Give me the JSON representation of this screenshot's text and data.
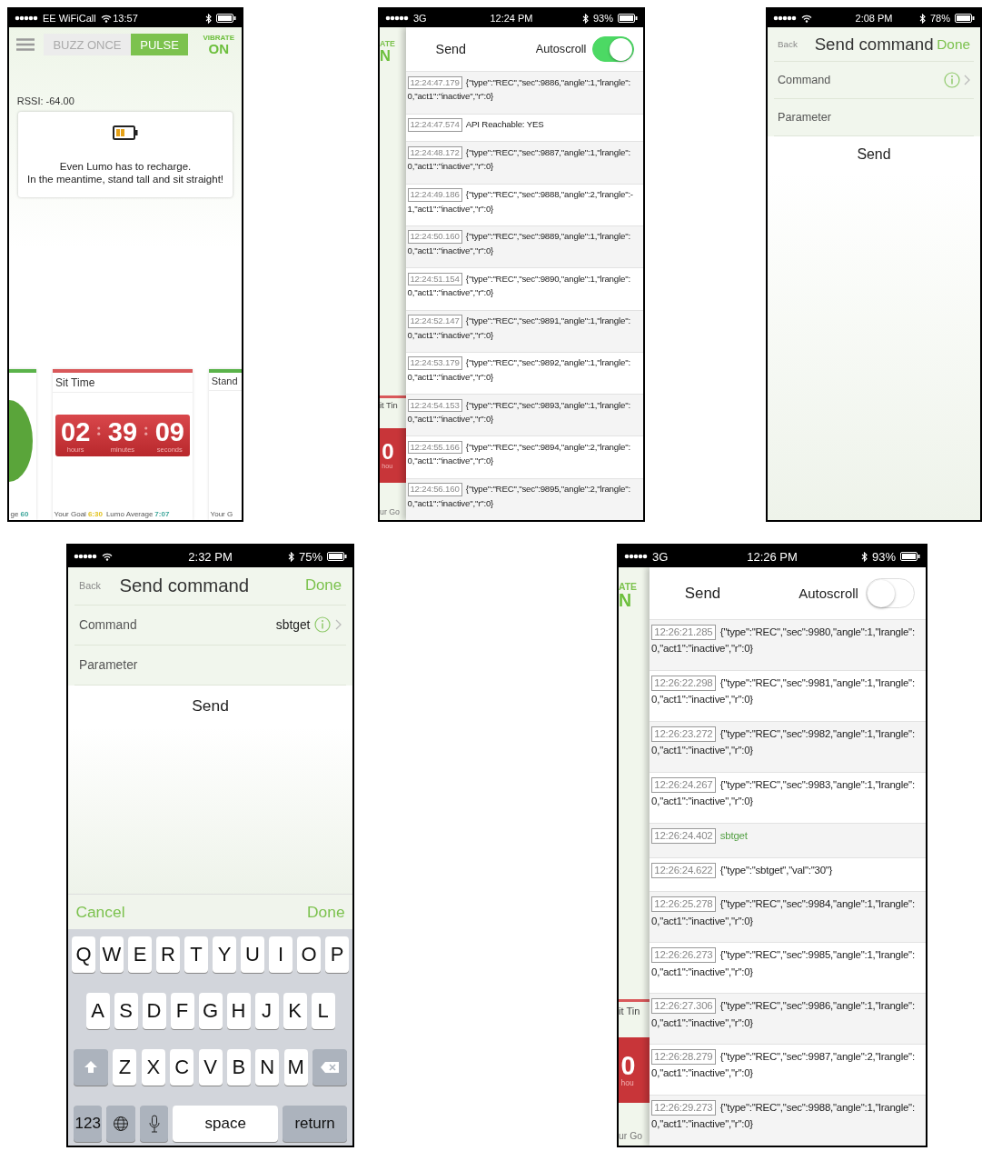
{
  "screens": [
    {
      "kind": "dashboard",
      "status": {
        "carrier": "EE WiFiCall",
        "wifi": true,
        "time": "13:57"
      },
      "mode_tabs": [
        {
          "label": "BUZZ ONCE",
          "selected": false
        },
        {
          "label": "PULSE",
          "selected": true
        }
      ],
      "vibrate": {
        "label": "VIBRATE",
        "value": "ON"
      },
      "rssi": "RSSI: -64.00",
      "notice": {
        "lines": [
          "Even Lumo has to recharge.",
          "In the meantime, stand tall and sit straight!"
        ]
      },
      "cards": [
        {
          "kind": "left",
          "color": "#5ab34a",
          "footer": [
            {
              "label": "ge",
              "value": "60",
              "color": "#3fa79c"
            }
          ]
        },
        {
          "kind": "middle",
          "color": "#d9585a",
          "title": "Sit Time",
          "timer": [
            {
              "value": "02",
              "unit": "hours"
            },
            {
              "value": "39",
              "unit": "minutes"
            },
            {
              "value": "09",
              "unit": "seconds"
            }
          ],
          "footer": [
            {
              "label": "Your Goal",
              "value": "6:30",
              "color": "#e2c21e"
            },
            {
              "label": "Lumo Average",
              "value": "7:07",
              "color": "#3fa79c"
            }
          ]
        },
        {
          "kind": "right",
          "color": "#5ab34a",
          "title": "Stand",
          "footer": [
            {
              "label": "Your G"
            }
          ]
        }
      ]
    },
    {
      "kind": "log",
      "status": {
        "carrier": "3G",
        "time": "12:24 PM",
        "battery": "93%"
      },
      "behind": {
        "vibrate": "ATE",
        "on": "N",
        "card_title": "it Tin",
        "timer": "0",
        "unit": "hou",
        "footer": "ur Go"
      },
      "send": "Send",
      "autoscroll": {
        "label": "Autoscroll",
        "on": true
      },
      "entries": [
        {
          "time": "12:24:47.179",
          "kind": "received",
          "text": "{\"type\":\"REC\",\"sec\":9886,\"angle\":1,\"lrangle\":0,\"act1\":\"inactive\",\"r\":0}"
        },
        {
          "time": "12:24:47.574",
          "kind": "status",
          "text": "API Reachable: YES"
        },
        {
          "time": "12:24:48.172",
          "kind": "received",
          "text": "{\"type\":\"REC\",\"sec\":9887,\"angle\":1,\"lrangle\":0,\"act1\":\"inactive\",\"r\":0}"
        },
        {
          "time": "12:24:49.186",
          "kind": "received",
          "text": "{\"type\":\"REC\",\"sec\":9888,\"angle\":2,\"lrangle\":-1,\"act1\":\"inactive\",\"r\":0}"
        },
        {
          "time": "12:24:50.160",
          "kind": "received",
          "text": "{\"type\":\"REC\",\"sec\":9889,\"angle\":1,\"lrangle\":0,\"act1\":\"inactive\",\"r\":0}"
        },
        {
          "time": "12:24:51.154",
          "kind": "received",
          "text": "{\"type\":\"REC\",\"sec\":9890,\"angle\":1,\"lrangle\":0,\"act1\":\"inactive\",\"r\":0}"
        },
        {
          "time": "12:24:52.147",
          "kind": "received",
          "text": "{\"type\":\"REC\",\"sec\":9891,\"angle\":1,\"lrangle\":0,\"act1\":\"inactive\",\"r\":0}"
        },
        {
          "time": "12:24:53.179",
          "kind": "received",
          "text": "{\"type\":\"REC\",\"sec\":9892,\"angle\":1,\"lrangle\":0,\"act1\":\"inactive\",\"r\":0}"
        },
        {
          "time": "12:24:54.153",
          "kind": "received",
          "text": "{\"type\":\"REC\",\"sec\":9893,\"angle\":1,\"lrangle\":0,\"act1\":\"inactive\",\"r\":0}"
        },
        {
          "time": "12:24:55.166",
          "kind": "received",
          "text": "{\"type\":\"REC\",\"sec\":9894,\"angle\":2,\"lrangle\":0,\"act1\":\"inactive\",\"r\":0}"
        },
        {
          "time": "12:24:56.160",
          "kind": "received",
          "text": "{\"type\":\"REC\",\"sec\":9895,\"angle\":2,\"lrangle\":0,\"act1\":\"inactive\",\"r\":0}"
        }
      ]
    },
    {
      "kind": "command",
      "status": {
        "wifi": true,
        "time": "2:08 PM",
        "battery": "78%"
      },
      "nav": {
        "back": "Back",
        "title": "Send command",
        "done": "Done"
      },
      "rows": [
        {
          "label": "Command",
          "info": true
        },
        {
          "label": "Parameter",
          "info": false
        }
      ],
      "send": "Send"
    },
    {
      "kind": "command",
      "status": {
        "wifi": true,
        "time": "2:32 PM",
        "battery": "75%"
      },
      "nav": {
        "back": "Back",
        "title": "Send command",
        "done": "Done"
      },
      "rows": [
        {
          "label": "Command",
          "value": "sbtget",
          "info": true
        },
        {
          "label": "Parameter",
          "info": false
        }
      ],
      "send": "Send",
      "keyboard": {
        "toolbar": {
          "cancel": "Cancel",
          "done": "Done"
        },
        "key_rows": [
          {
            "keys": [
              {
                "kind": "letter",
                "label": "Q"
              },
              {
                "kind": "letter",
                "label": "W"
              },
              {
                "kind": "letter",
                "label": "E"
              },
              {
                "kind": "letter",
                "label": "R"
              },
              {
                "kind": "letter",
                "label": "T"
              },
              {
                "kind": "letter",
                "label": "Y"
              },
              {
                "kind": "letter",
                "label": "U"
              },
              {
                "kind": "letter",
                "label": "I"
              },
              {
                "kind": "letter",
                "label": "O"
              },
              {
                "kind": "letter",
                "label": "P"
              }
            ]
          },
          {
            "keys": [
              {
                "kind": "letter",
                "label": "A"
              },
              {
                "kind": "letter",
                "label": "S"
              },
              {
                "kind": "letter",
                "label": "D"
              },
              {
                "kind": "letter",
                "label": "F"
              },
              {
                "kind": "letter",
                "label": "G"
              },
              {
                "kind": "letter",
                "label": "H"
              },
              {
                "kind": "letter",
                "label": "J"
              },
              {
                "kind": "letter",
                "label": "K"
              },
              {
                "kind": "letter",
                "label": "L"
              }
            ]
          },
          {
            "keys": [
              {
                "kind": "shift"
              },
              {
                "kind": "letter",
                "label": "Z"
              },
              {
                "kind": "letter",
                "label": "X"
              },
              {
                "kind": "letter",
                "label": "C"
              },
              {
                "kind": "letter",
                "label": "V"
              },
              {
                "kind": "letter",
                "label": "B"
              },
              {
                "kind": "letter",
                "label": "N"
              },
              {
                "kind": "letter",
                "label": "M"
              },
              {
                "kind": "delete"
              }
            ]
          },
          {
            "keys": [
              {
                "kind": "numbers",
                "label": "123"
              },
              {
                "kind": "globe"
              },
              {
                "kind": "mic"
              },
              {
                "kind": "space",
                "label": "space"
              },
              {
                "kind": "return",
                "label": "return"
              }
            ]
          }
        ]
      }
    },
    {
      "kind": "log",
      "status": {
        "carrier": "3G",
        "time": "12:26 PM",
        "battery": "93%"
      },
      "behind": {
        "vibrate": "ATE",
        "on": "N",
        "card_title": "it Tin",
        "timer": "0",
        "unit": "hou",
        "footer": "ur Go"
      },
      "send": "Send",
      "autoscroll": {
        "label": "Autoscroll",
        "on": false
      },
      "entries": [
        {
          "time": "12:26:21.285",
          "kind": "received",
          "text": "{\"type\":\"REC\",\"sec\":9980,\"angle\":1,\"lrangle\":0,\"act1\":\"inactive\",\"r\":0}"
        },
        {
          "time": "12:26:22.298",
          "kind": "received",
          "text": "{\"type\":\"REC\",\"sec\":9981,\"angle\":1,\"lrangle\":0,\"act1\":\"inactive\",\"r\":0}"
        },
        {
          "time": "12:26:23.272",
          "kind": "received",
          "text": "{\"type\":\"REC\",\"sec\":9982,\"angle\":1,\"lrangle\":0,\"act1\":\"inactive\",\"r\":0}"
        },
        {
          "time": "12:26:24.267",
          "kind": "received",
          "text": "{\"type\":\"REC\",\"sec\":9983,\"angle\":1,\"lrangle\":0,\"act1\":\"inactive\",\"r\":0}"
        },
        {
          "time": "12:26:24.402",
          "kind": "sent",
          "text": "sbtget"
        },
        {
          "time": "12:26:24.622",
          "kind": "received",
          "text": "{\"type\":\"sbtget\",\"val\":\"30\"}"
        },
        {
          "time": "12:26:25.278",
          "kind": "received",
          "text": "{\"type\":\"REC\",\"sec\":9984,\"angle\":1,\"lrangle\":0,\"act1\":\"inactive\",\"r\":0}"
        },
        {
          "time": "12:26:26.273",
          "kind": "received",
          "text": "{\"type\":\"REC\",\"sec\":9985,\"angle\":1,\"lrangle\":0,\"act1\":\"inactive\",\"r\":0}"
        },
        {
          "time": "12:26:27.306",
          "kind": "received",
          "text": "{\"type\":\"REC\",\"sec\":9986,\"angle\":1,\"lrangle\":0,\"act1\":\"inactive\",\"r\":0}"
        },
        {
          "time": "12:26:28.279",
          "kind": "received",
          "text": "{\"type\":\"REC\",\"sec\":9987,\"angle\":2,\"lrangle\":0,\"act1\":\"inactive\",\"r\":0}"
        },
        {
          "time": "12:26:29.273",
          "kind": "received",
          "text": "{\"type\":\"REC\",\"sec\":9988,\"angle\":1,\"lrangle\":0,\"act1\":\"inactive\",\"r\":0}"
        }
      ]
    }
  ]
}
